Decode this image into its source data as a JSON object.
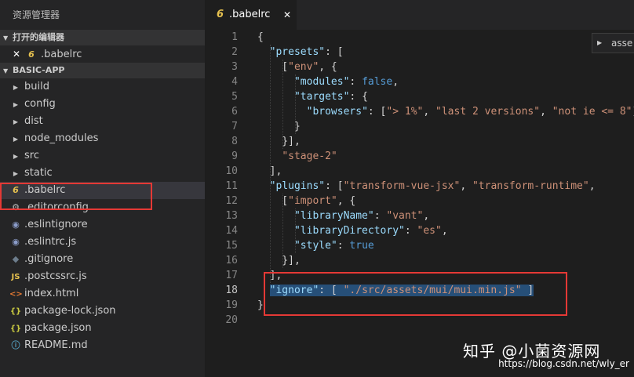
{
  "sidebar": {
    "title": "资源管理器",
    "open_editors": {
      "header": "打开的编辑器",
      "items": [
        {
          "close": "✕",
          "icon": "6",
          "label": ".babelrc"
        }
      ]
    },
    "project": {
      "header": "BASIC-APP",
      "folders": [
        {
          "label": "build"
        },
        {
          "label": "config"
        },
        {
          "label": "dist"
        },
        {
          "label": "node_modules"
        },
        {
          "label": "src"
        },
        {
          "label": "static"
        }
      ],
      "files": [
        {
          "label": ".babelrc",
          "icon": "6",
          "icon_name": "babel-icon",
          "icon_color": "#e6c14f"
        },
        {
          "label": ".editorconfig",
          "icon": "⚙",
          "icon_name": "gear-icon",
          "icon_color": "#bfbfbf"
        },
        {
          "label": ".eslintignore",
          "icon": "◉",
          "icon_name": "eslint-icon",
          "icon_color": "#8b9cc9"
        },
        {
          "label": ".eslintrc.js",
          "icon": "◉",
          "icon_name": "eslint-icon",
          "icon_color": "#8b9cc9"
        },
        {
          "label": ".gitignore",
          "icon": "◆",
          "icon_name": "git-icon",
          "icon_color": "#6d7d8c"
        },
        {
          "label": ".postcssrc.js",
          "icon": "JS",
          "icon_name": "javascript-icon",
          "icon_color": "#e6c14f"
        },
        {
          "label": "index.html",
          "icon": "<>",
          "icon_name": "html-icon",
          "icon_color": "#e37933"
        },
        {
          "label": "package-lock.json",
          "icon": "{}",
          "icon_name": "json-icon",
          "icon_color": "#cbcb41"
        },
        {
          "label": "package.json",
          "icon": "{}",
          "icon_name": "json-icon",
          "icon_color": "#cbcb41"
        },
        {
          "label": "README.md",
          "icon": "ⓘ",
          "icon_name": "info-icon",
          "icon_color": "#519aba"
        }
      ]
    }
  },
  "editor": {
    "tab": {
      "icon": "6",
      "label": ".babelrc",
      "close": "✕"
    },
    "breadcrumb": "asse",
    "active_line": 18,
    "lines": [
      {
        "n": "1",
        "tokens": [
          {
            "t": "{",
            "c": "p"
          }
        ]
      },
      {
        "n": "2",
        "tokens": [
          {
            "t": "  ",
            "c": "p"
          },
          {
            "t": "\"presets\"",
            "c": "k"
          },
          {
            "t": ": [",
            "c": "p"
          }
        ]
      },
      {
        "n": "3",
        "tokens": [
          {
            "t": "    [",
            "c": "p"
          },
          {
            "t": "\"env\"",
            "c": "s"
          },
          {
            "t": ", {",
            "c": "p"
          }
        ]
      },
      {
        "n": "4",
        "tokens": [
          {
            "t": "      ",
            "c": "p"
          },
          {
            "t": "\"modules\"",
            "c": "k"
          },
          {
            "t": ": ",
            "c": "p"
          },
          {
            "t": "false",
            "c": "b"
          },
          {
            "t": ",",
            "c": "p"
          }
        ]
      },
      {
        "n": "5",
        "tokens": [
          {
            "t": "      ",
            "c": "p"
          },
          {
            "t": "\"targets\"",
            "c": "k"
          },
          {
            "t": ": {",
            "c": "p"
          }
        ]
      },
      {
        "n": "6",
        "tokens": [
          {
            "t": "        ",
            "c": "p"
          },
          {
            "t": "\"browsers\"",
            "c": "k"
          },
          {
            "t": ": [",
            "c": "p"
          },
          {
            "t": "\"> 1%\"",
            "c": "s"
          },
          {
            "t": ", ",
            "c": "p"
          },
          {
            "t": "\"last 2 versions\"",
            "c": "s"
          },
          {
            "t": ", ",
            "c": "p"
          },
          {
            "t": "\"not ie <= 8\"",
            "c": "s"
          },
          {
            "t": "]",
            "c": "p"
          }
        ]
      },
      {
        "n": "7",
        "tokens": [
          {
            "t": "      }",
            "c": "p"
          }
        ]
      },
      {
        "n": "8",
        "tokens": [
          {
            "t": "    }],",
            "c": "p"
          }
        ]
      },
      {
        "n": "9",
        "tokens": [
          {
            "t": "    ",
            "c": "p"
          },
          {
            "t": "\"stage-2\"",
            "c": "s"
          }
        ]
      },
      {
        "n": "10",
        "tokens": [
          {
            "t": "  ],",
            "c": "p"
          }
        ]
      },
      {
        "n": "11",
        "tokens": [
          {
            "t": "  ",
            "c": "p"
          },
          {
            "t": "\"plugins\"",
            "c": "k"
          },
          {
            "t": ": [",
            "c": "p"
          },
          {
            "t": "\"transform-vue-jsx\"",
            "c": "s"
          },
          {
            "t": ", ",
            "c": "p"
          },
          {
            "t": "\"transform-runtime\"",
            "c": "s"
          },
          {
            "t": ",",
            "c": "p"
          }
        ]
      },
      {
        "n": "12",
        "tokens": [
          {
            "t": "    [",
            "c": "p"
          },
          {
            "t": "\"import\"",
            "c": "s"
          },
          {
            "t": ", {",
            "c": "p"
          }
        ]
      },
      {
        "n": "13",
        "tokens": [
          {
            "t": "      ",
            "c": "p"
          },
          {
            "t": "\"libraryName\"",
            "c": "k"
          },
          {
            "t": ": ",
            "c": "p"
          },
          {
            "t": "\"vant\"",
            "c": "s"
          },
          {
            "t": ",",
            "c": "p"
          }
        ]
      },
      {
        "n": "14",
        "tokens": [
          {
            "t": "      ",
            "c": "p"
          },
          {
            "t": "\"libraryDirectory\"",
            "c": "k"
          },
          {
            "t": ": ",
            "c": "p"
          },
          {
            "t": "\"es\"",
            "c": "s"
          },
          {
            "t": ",",
            "c": "p"
          }
        ]
      },
      {
        "n": "15",
        "tokens": [
          {
            "t": "      ",
            "c": "p"
          },
          {
            "t": "\"style\"",
            "c": "k"
          },
          {
            "t": ": ",
            "c": "p"
          },
          {
            "t": "true",
            "c": "b"
          }
        ]
      },
      {
        "n": "16",
        "tokens": [
          {
            "t": "    }],",
            "c": "p"
          }
        ]
      },
      {
        "n": "17",
        "tokens": [
          {
            "t": "  ],",
            "c": "p"
          }
        ]
      },
      {
        "n": "18",
        "selected": true,
        "tokens": [
          {
            "t": "  ",
            "c": "p"
          },
          {
            "t": "\"ignore\"",
            "c": "k"
          },
          {
            "t": ": [ ",
            "c": "p"
          },
          {
            "t": "\"./src/assets/mui/mui.min.js\"",
            "c": "s"
          },
          {
            "t": " ]",
            "c": "p"
          }
        ]
      },
      {
        "n": "19",
        "tokens": [
          {
            "t": "}",
            "c": "p"
          }
        ]
      },
      {
        "n": "20",
        "tokens": []
      }
    ]
  },
  "watermark": {
    "main": "知乎 @小菌资源网",
    "url": "https://blog.csdn.net/wly_er"
  },
  "colors": {
    "sidebar_bg": "#252526",
    "editor_bg": "#1e1e1e",
    "selection": "#264f78",
    "annotation_red": "#e53935"
  }
}
